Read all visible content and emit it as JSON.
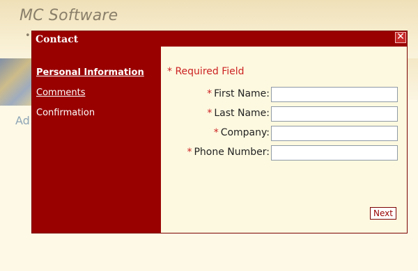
{
  "background": {
    "brand": "MC Software",
    "tagline_partial": "•",
    "left_text_partial": "Ad"
  },
  "modal": {
    "title": "Contact",
    "close_label": "✕",
    "nav": [
      {
        "label": "Personal Information",
        "state": "active"
      },
      {
        "label": "Comments",
        "state": "link"
      },
      {
        "label": "Confirmation",
        "state": "disabled"
      }
    ],
    "required_note": {
      "star": "*",
      "text": "Required Field"
    },
    "fields": [
      {
        "star": "*",
        "label": "First Name:",
        "value": "",
        "placeholder": ""
      },
      {
        "star": "*",
        "label": "Last Name:",
        "value": "",
        "placeholder": ""
      },
      {
        "star": "*",
        "label": "Company:",
        "value": "",
        "placeholder": ""
      },
      {
        "star": "*",
        "label": "Phone Number:",
        "value": "",
        "placeholder": ""
      }
    ],
    "next_label": "Next"
  },
  "colors": {
    "brand_red": "#990000",
    "required_red": "#cc2222",
    "content_bg": "#fdf9e0"
  }
}
